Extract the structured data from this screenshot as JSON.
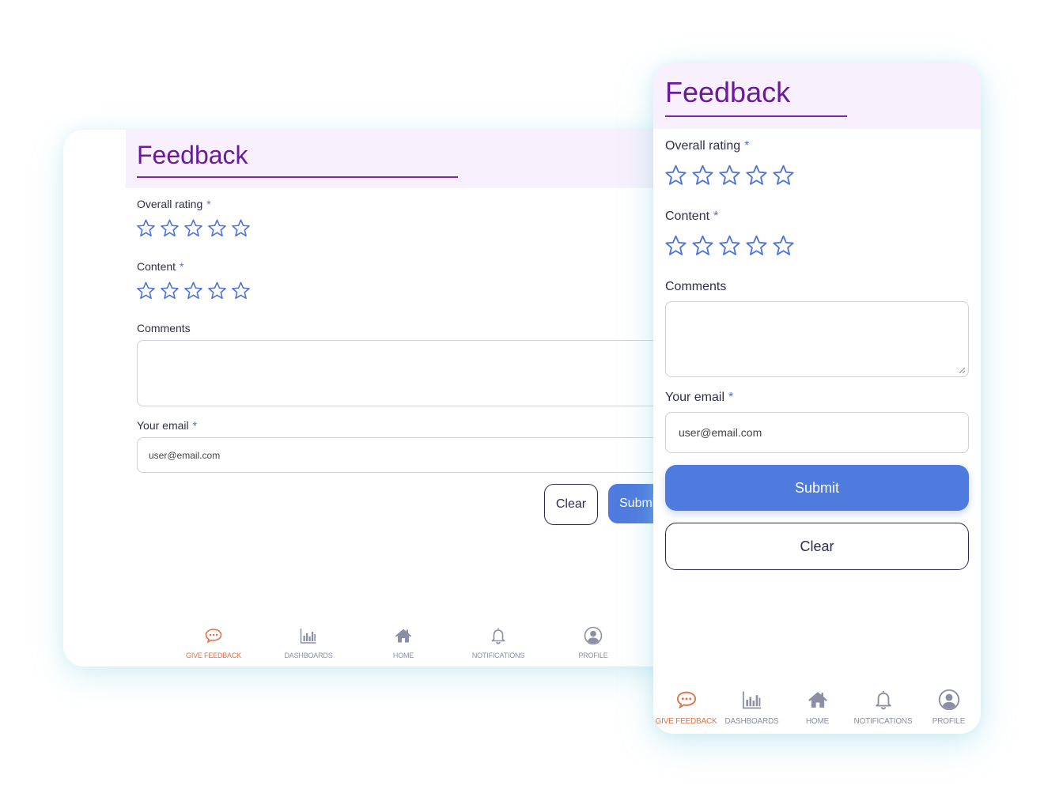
{
  "form": {
    "title": "Feedback",
    "overall_rating_label": "Overall rating",
    "content_label": "Content",
    "comments_label": "Comments",
    "email_label": "Your email",
    "required_mark": "*",
    "email_placeholder": "user@email.com",
    "overall_rating_value": 0,
    "content_value": 0,
    "star_count": 5,
    "submit_label": "Submit",
    "clear_label": "Clear"
  },
  "nav": {
    "items": [
      {
        "label": "GIVE FEEDBACK",
        "icon": "chat-bubble-icon",
        "active": true
      },
      {
        "label": "DASHBOARDS",
        "icon": "bar-chart-icon",
        "active": false
      },
      {
        "label": "HOME",
        "icon": "home-icon",
        "active": false
      },
      {
        "label": "NOTIFICATIONS",
        "icon": "bell-icon",
        "active": false
      },
      {
        "label": "PROFILE",
        "icon": "user-circle-icon",
        "active": false
      }
    ]
  },
  "colors": {
    "title": "#6a1b9a",
    "header_bg": "#f8f0fc",
    "star_outline": "#4a72d9",
    "submit_bg": "#4f7bde",
    "active_nav": "#e07148",
    "inactive_nav": "#8a8fa3"
  }
}
